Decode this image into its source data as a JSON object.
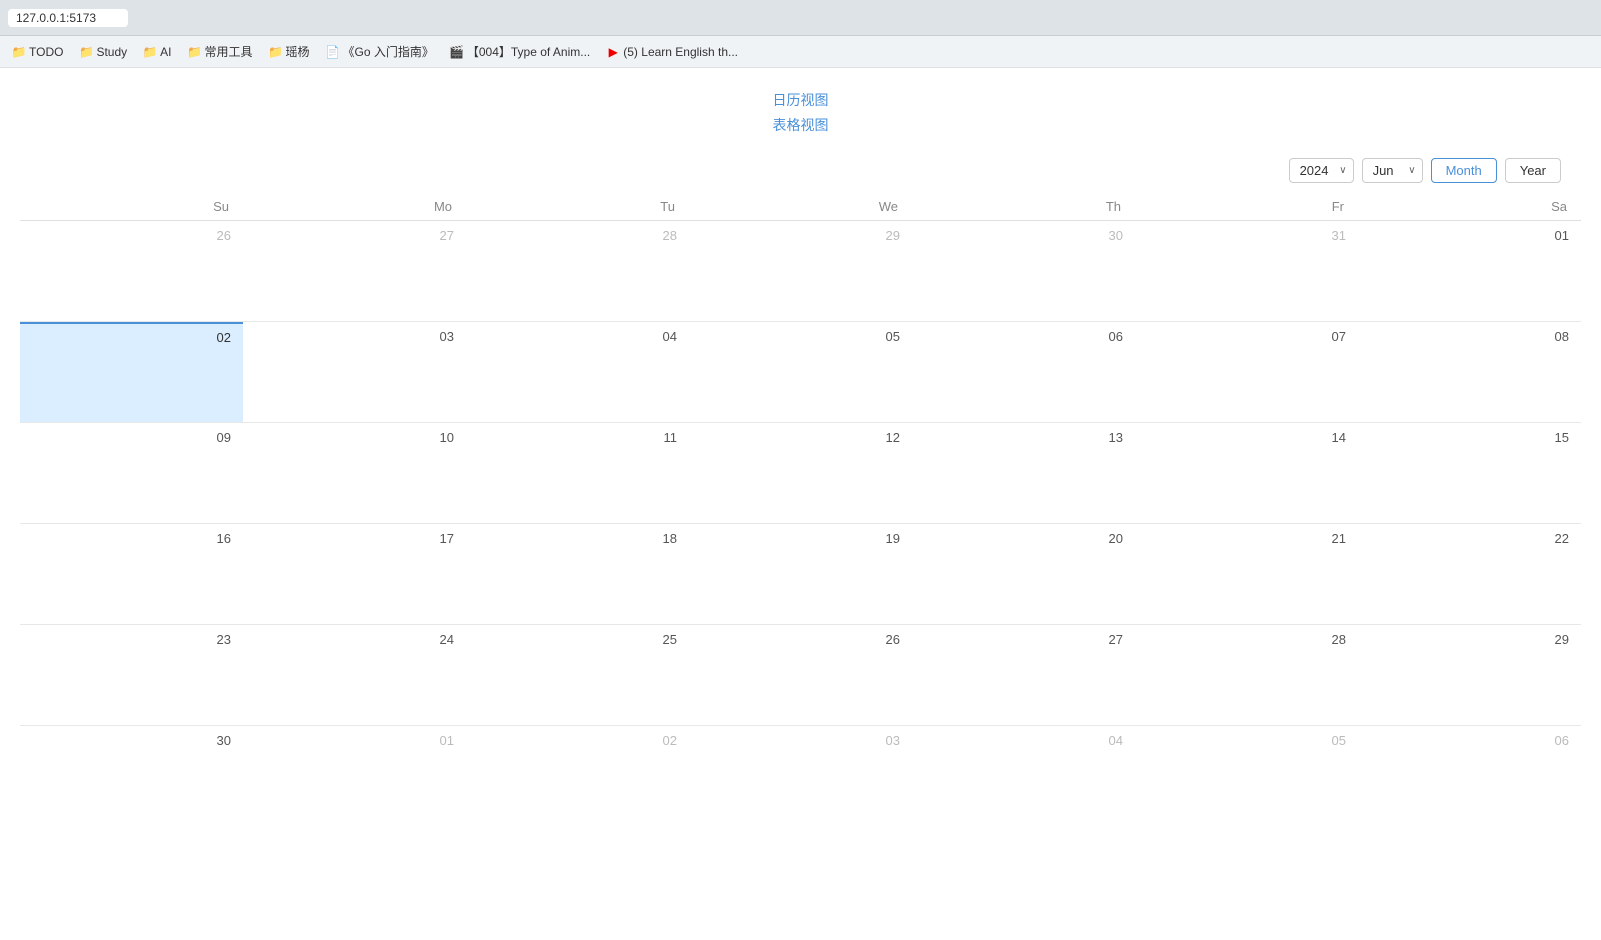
{
  "browser": {
    "address": "127.0.0.1:5173"
  },
  "bookmarks": [
    {
      "label": "TODO",
      "icon": "📁",
      "type": "folder"
    },
    {
      "label": "Study",
      "icon": "📁",
      "type": "folder"
    },
    {
      "label": "AI",
      "icon": "📁",
      "type": "folder"
    },
    {
      "label": "常用工具",
      "icon": "📁",
      "type": "folder"
    },
    {
      "label": "瑶杨",
      "icon": "📁",
      "type": "folder"
    },
    {
      "label": "《Go 入门指南》",
      "icon": "📄",
      "type": "page"
    },
    {
      "label": "【004】Type of Anim...",
      "icon": "📺",
      "type": "video"
    },
    {
      "label": "(5) Learn English th...",
      "icon": "▶",
      "type": "youtube"
    }
  ],
  "top_links": [
    {
      "label": "日历视图",
      "href": "#"
    },
    {
      "label": "表格视图",
      "href": "#"
    }
  ],
  "controls": {
    "year": "2024",
    "month": "Jun",
    "month_label": "Month",
    "year_label": "Year"
  },
  "calendar": {
    "weekdays": [
      "Su",
      "Mo",
      "Tu",
      "We",
      "Th",
      "Fr",
      "Sa"
    ],
    "rows": [
      {
        "cells": [
          {
            "date": "26",
            "greyed": true
          },
          {
            "date": "27",
            "greyed": true
          },
          {
            "date": "28",
            "greyed": true
          },
          {
            "date": "29",
            "greyed": true
          },
          {
            "date": "30",
            "greyed": true
          },
          {
            "date": "31",
            "greyed": true
          },
          {
            "date": "01",
            "greyed": false
          }
        ]
      },
      {
        "cells": [
          {
            "date": "02",
            "today": true
          },
          {
            "date": "03"
          },
          {
            "date": "04"
          },
          {
            "date": "05"
          },
          {
            "date": "06"
          },
          {
            "date": "07"
          },
          {
            "date": "08"
          }
        ]
      },
      {
        "cells": [
          {
            "date": "09"
          },
          {
            "date": "10"
          },
          {
            "date": "11"
          },
          {
            "date": "12"
          },
          {
            "date": "13"
          },
          {
            "date": "14"
          },
          {
            "date": "15"
          }
        ]
      },
      {
        "cells": [
          {
            "date": "16"
          },
          {
            "date": "17"
          },
          {
            "date": "18"
          },
          {
            "date": "19"
          },
          {
            "date": "20"
          },
          {
            "date": "21"
          },
          {
            "date": "22"
          }
        ]
      },
      {
        "cells": [
          {
            "date": "23"
          },
          {
            "date": "24"
          },
          {
            "date": "25"
          },
          {
            "date": "26"
          },
          {
            "date": "27"
          },
          {
            "date": "28"
          },
          {
            "date": "29"
          }
        ]
      },
      {
        "cells": [
          {
            "date": "30"
          },
          {
            "date": "01",
            "greyed": true
          },
          {
            "date": "02",
            "greyed": true
          },
          {
            "date": "03",
            "greyed": true
          },
          {
            "date": "04",
            "greyed": true
          },
          {
            "date": "05",
            "greyed": true
          },
          {
            "date": "06",
            "greyed": true
          }
        ]
      }
    ]
  }
}
